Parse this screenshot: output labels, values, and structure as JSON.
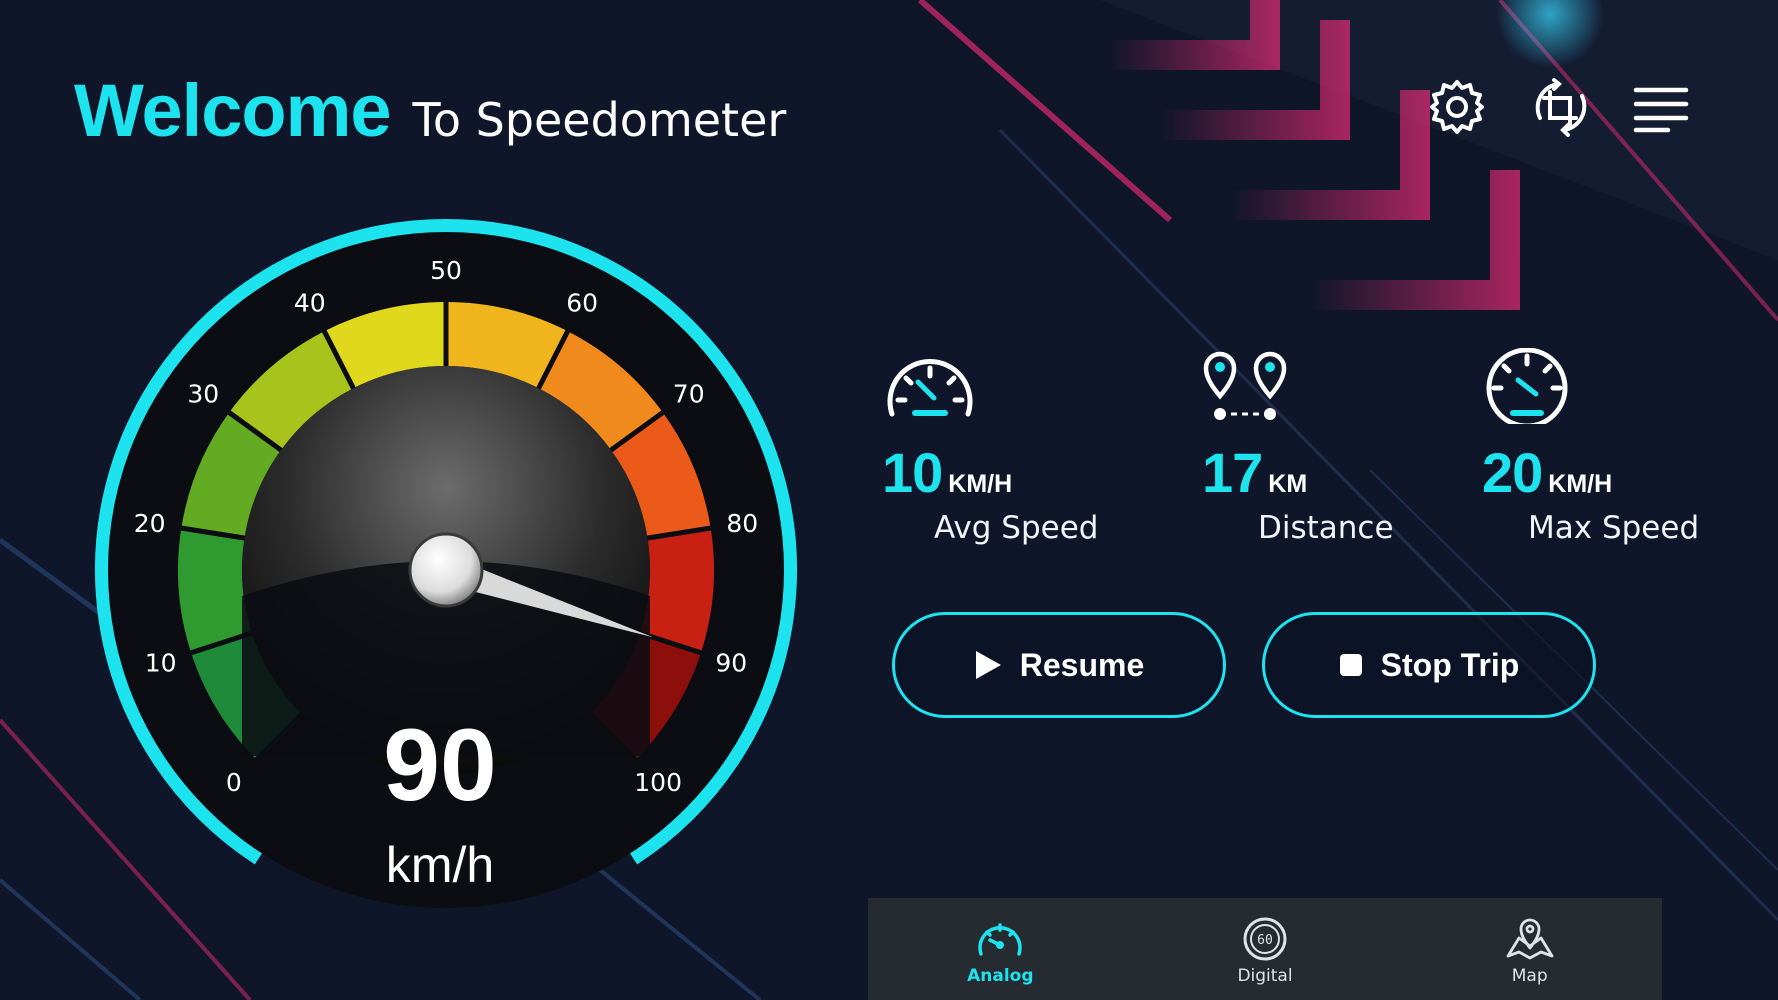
{
  "header": {
    "title_welcome": "Welcome",
    "title_sub": "To Speedometer"
  },
  "toolbar": [
    {
      "name": "settings",
      "icon": "gear-icon"
    },
    {
      "name": "rotate",
      "icon": "crop-rotate-icon"
    },
    {
      "name": "menu",
      "icon": "menu-icon"
    }
  ],
  "gauge": {
    "value": 90,
    "unit": "km/h",
    "min": 0,
    "max": 100,
    "ticks": [
      "0",
      "10",
      "20",
      "30",
      "40",
      "50",
      "60",
      "70",
      "80",
      "90",
      "100"
    ]
  },
  "stats": {
    "avg": {
      "value": "10",
      "unit": "KM/H",
      "label": "Avg Speed",
      "icon": "speedometer-icon"
    },
    "distance": {
      "value": "17",
      "unit": "KM",
      "label": "Distance",
      "icon": "route-pins-icon"
    },
    "max": {
      "value": "20",
      "unit": "KM/H",
      "label": "Max Speed",
      "icon": "speedometer-icon"
    }
  },
  "actions": {
    "resume_label": "Resume",
    "stop_label": "Stop Trip"
  },
  "nav": {
    "items": [
      {
        "label": "Analog",
        "icon": "analog-gauge-icon",
        "active": true
      },
      {
        "label": "Digital",
        "icon": "digital-gauge-icon",
        "active": false
      },
      {
        "label": "Map",
        "icon": "map-pin-icon",
        "active": false
      }
    ]
  },
  "colors": {
    "accent": "#1de3ee",
    "background": "#0f1526",
    "nav_background": "#262a31"
  }
}
